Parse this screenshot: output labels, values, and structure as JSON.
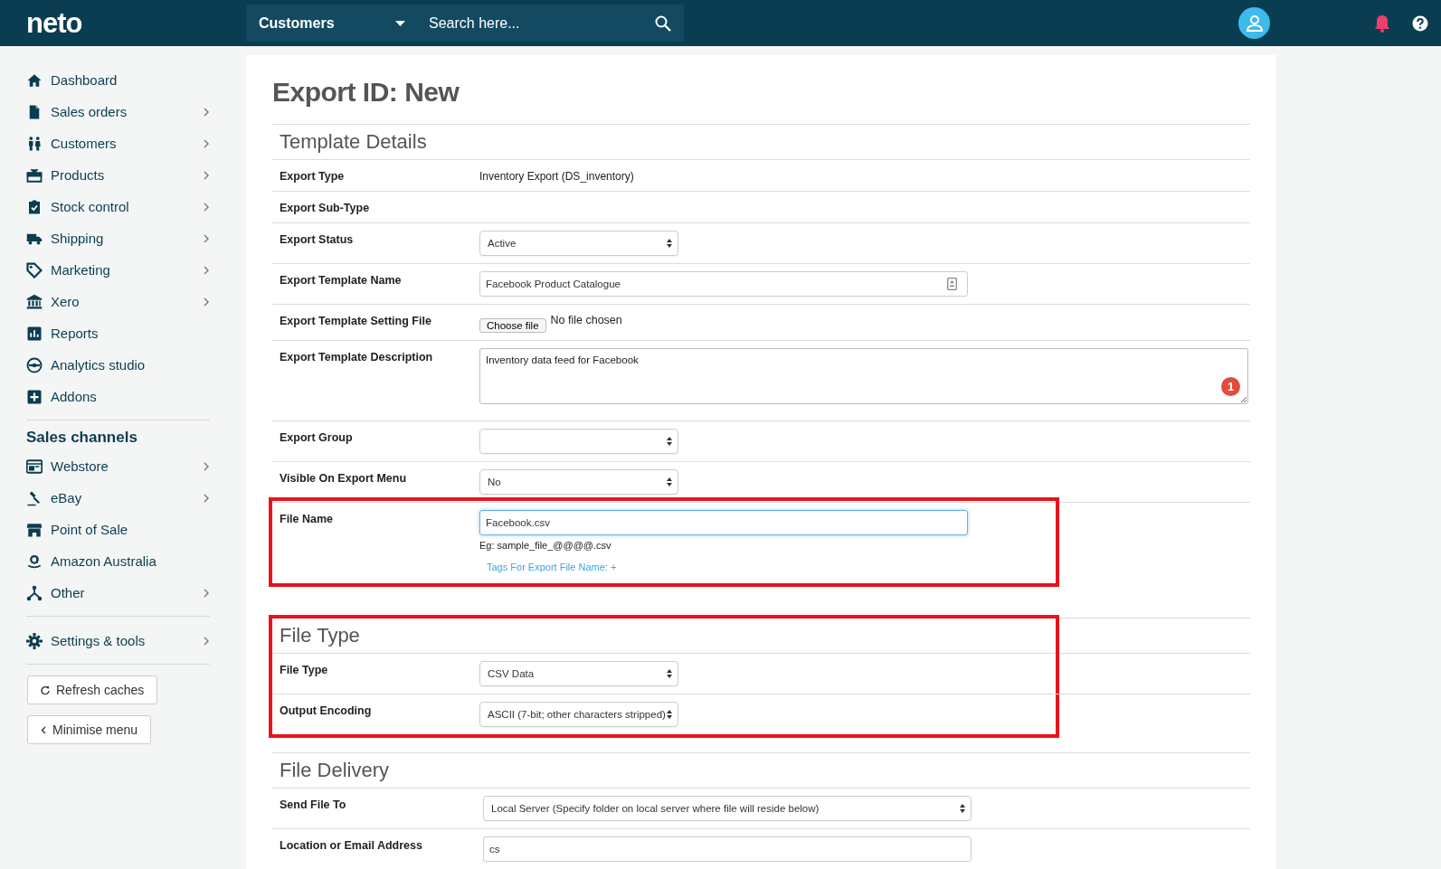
{
  "header": {
    "logo": "neto",
    "category": "Customers",
    "search": {
      "placeholder": "Search here..."
    }
  },
  "sidebar": {
    "groups": [
      {
        "items": [
          {
            "label": "Dashboard",
            "expandable": false
          },
          {
            "label": "Sales orders",
            "expandable": true
          },
          {
            "label": "Customers",
            "expandable": true
          },
          {
            "label": "Products",
            "expandable": true
          },
          {
            "label": "Stock control",
            "expandable": true
          },
          {
            "label": "Shipping",
            "expandable": true
          },
          {
            "label": "Marketing",
            "expandable": true
          },
          {
            "label": "Xero",
            "expandable": true
          },
          {
            "label": "Reports",
            "expandable": false
          },
          {
            "label": "Analytics studio",
            "expandable": false
          },
          {
            "label": "Addons",
            "expandable": false
          }
        ]
      },
      {
        "title": "Sales channels",
        "items": [
          {
            "label": "Webstore",
            "expandable": true
          },
          {
            "label": "eBay",
            "expandable": true
          },
          {
            "label": "Point of Sale",
            "expandable": false
          },
          {
            "label": "Amazon Australia",
            "expandable": false
          },
          {
            "label": "Other",
            "expandable": true
          }
        ]
      },
      {
        "items": [
          {
            "label": "Settings & tools",
            "expandable": true
          }
        ]
      }
    ],
    "buttons": [
      {
        "label": "Refresh caches",
        "kind": "refresh"
      },
      {
        "label": "Minimise menu",
        "kind": "minimise"
      }
    ]
  },
  "page": {
    "title": "Export ID: New",
    "sections": [
      {
        "title": "Template Details",
        "highlighted": false,
        "rows": [
          {
            "label": "Export Type",
            "kind": "static",
            "value": "Inventory Export (DS_inventory)",
            "highlighted": false
          },
          {
            "label": "Export Sub-Type",
            "kind": "static",
            "highlighted": false
          },
          {
            "label": "Export Status",
            "kind": "select",
            "value": "Active",
            "highlighted": false
          },
          {
            "label": "Export Template Name",
            "kind": "input",
            "value": "Facebook Product Catalogue",
            "highlighted": false,
            "focused": false
          },
          {
            "label": "Export Template Setting File",
            "kind": "file",
            "button": "Choose file",
            "value": "No file chosen",
            "highlighted": false
          },
          {
            "label": "Export Template Description",
            "kind": "textarea",
            "value": "Inventory data feed for Facebook",
            "badge": "1",
            "highlighted": false
          },
          {
            "label": "Export Group",
            "kind": "select",
            "highlighted": false
          },
          {
            "label": "Visible On Export Menu",
            "kind": "select",
            "value": "No",
            "highlighted": false
          },
          {
            "label": "File Name",
            "kind": "input",
            "value": "Facebook.csv",
            "focused": true,
            "hint": "Eg: sample_file_@@@@.csv",
            "link": "Tags For Export File Name: +",
            "highlighted": true
          }
        ]
      },
      {
        "title": "File Type",
        "highlighted": true,
        "rows": [
          {
            "label": "File Type",
            "kind": "select",
            "value": "CSV Data",
            "highlighted": false
          },
          {
            "label": "Output Encoding",
            "kind": "select",
            "value": "ASCII (7-bit; other characters stripped)",
            "highlighted": false
          }
        ]
      },
      {
        "title": "File Delivery",
        "highlighted": false,
        "rows": [
          {
            "label": "Send File To",
            "kind": "select",
            "value": "Local Server (Specify folder on local server where file will reside below)",
            "highlighted": false
          },
          {
            "label": "Location or Email Address",
            "kind": "input",
            "value": "cs",
            "focused": false,
            "highlighted": false
          }
        ]
      }
    ]
  }
}
